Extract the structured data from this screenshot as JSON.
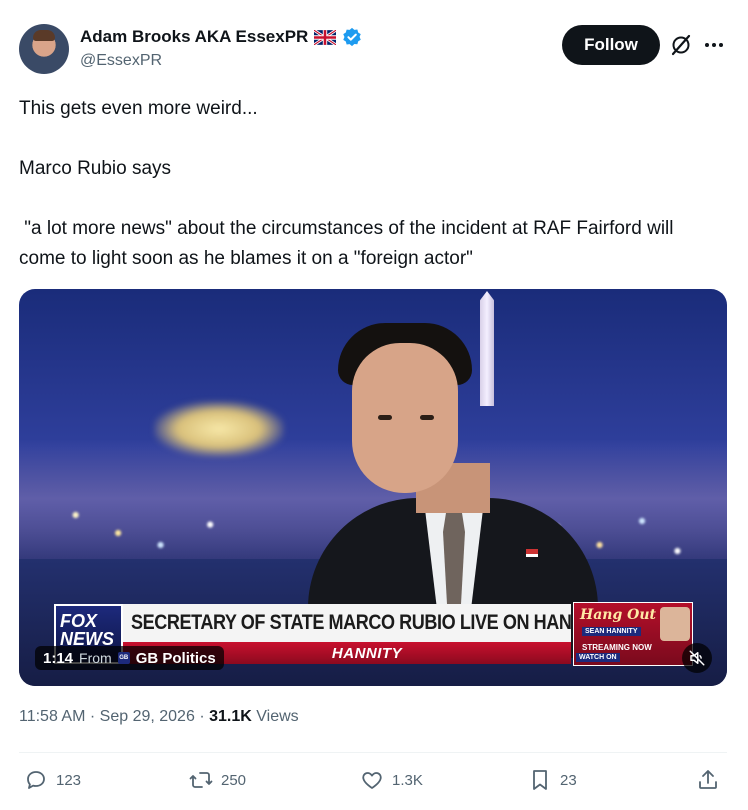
{
  "author": {
    "display_name": "Adam Brooks AKA EssexPR",
    "handle": "@EssexPR",
    "flag_icon": "uk-flag-icon",
    "verified_icon": "verified-badge-icon"
  },
  "header": {
    "follow_label": "Follow",
    "grok_icon": "grok-icon",
    "more_icon": "more-options-icon"
  },
  "tweet": {
    "paragraphs": [
      "This gets even more weird...",
      "Marco Rubio says",
      " \"a lot more news\" about the circumstances of the incident at RAF Fairford will come to light soon as he blames it on a \"foreign actor\""
    ]
  },
  "video": {
    "timecode": "1:14",
    "from_label": "From",
    "source": "GB Politics",
    "lower_third": {
      "network": "FOX NEWS",
      "headline": "SECRETARY OF STATE MARCO RUBIO LIVE ON HANNITY",
      "show": "HANNITY",
      "promo_title": "Hang Out",
      "promo_sub": "SEAN HANNITY",
      "promo_stream": "STREAMING NOW",
      "promo_watch": "WATCH ON"
    }
  },
  "meta": {
    "time": "11:58 AM",
    "date": "Sep 29, 2026",
    "views_count": "31.1K",
    "views_label": "Views"
  },
  "actions": {
    "replies": "123",
    "reposts": "250",
    "likes": "1.3K",
    "bookmarks": "23"
  },
  "colors": {
    "text_primary": "#0f1419",
    "text_secondary": "#536471",
    "verified_blue": "#1d9bf0",
    "follow_bg": "#0f1419"
  }
}
